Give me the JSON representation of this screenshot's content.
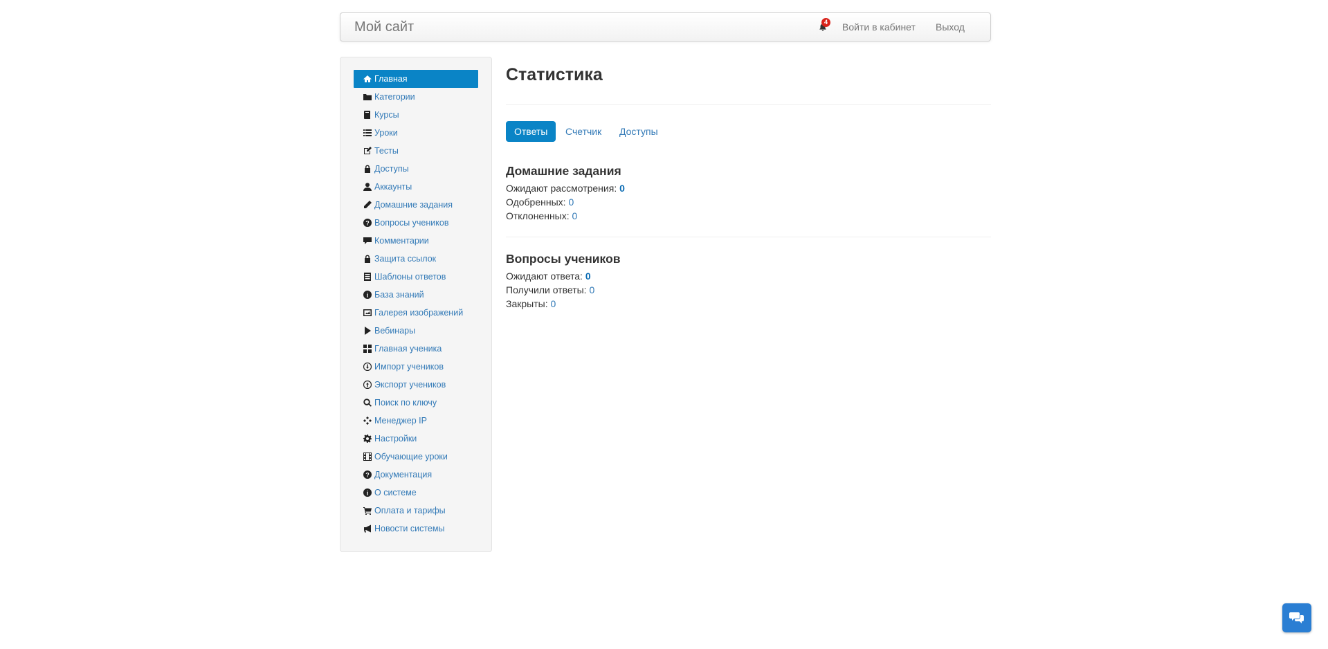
{
  "navbar": {
    "brand": "Мой сайт",
    "notification_count": "4",
    "links": [
      "Войти в кабинет",
      "Выход"
    ]
  },
  "sidebar": {
    "items": [
      {
        "label": "Главная",
        "icon": "home-icon",
        "active": true
      },
      {
        "label": "Категории",
        "icon": "folder-icon"
      },
      {
        "label": "Курсы",
        "icon": "book-icon"
      },
      {
        "label": "Уроки",
        "icon": "list-icon"
      },
      {
        "label": "Тесты",
        "icon": "edit-icon"
      },
      {
        "label": "Доступы",
        "icon": "lock-icon"
      },
      {
        "label": "Аккаунты",
        "icon": "user-icon"
      },
      {
        "label": "Домашние задания",
        "icon": "pencil-icon"
      },
      {
        "label": "Вопросы учеников",
        "icon": "question-icon"
      },
      {
        "label": "Комментарии",
        "icon": "comment-icon"
      },
      {
        "label": "Защита ссылок",
        "icon": "lock-icon"
      },
      {
        "label": "Шаблоны ответов",
        "icon": "template-icon"
      },
      {
        "label": "База знаний",
        "icon": "info-icon"
      },
      {
        "label": "Галерея изображений",
        "icon": "image-icon"
      },
      {
        "label": "Вебинары",
        "icon": "play-icon"
      },
      {
        "label": "Главная ученика",
        "icon": "dashboard-icon"
      },
      {
        "label": "Импорт учеников",
        "icon": "import-icon"
      },
      {
        "label": "Экспорт учеников",
        "icon": "export-icon"
      },
      {
        "label": "Поиск по ключу",
        "icon": "search-icon"
      },
      {
        "label": "Менеджер IP",
        "icon": "network-icon"
      },
      {
        "label": "Настройки",
        "icon": "gear-icon"
      },
      {
        "label": "Обучающие уроки",
        "icon": "film-icon"
      },
      {
        "label": "Документация",
        "icon": "question-icon"
      },
      {
        "label": "О системе",
        "icon": "info-icon"
      },
      {
        "label": "Оплата и тарифы",
        "icon": "cart-icon"
      },
      {
        "label": "Новости системы",
        "icon": "bullhorn-icon"
      }
    ]
  },
  "main": {
    "title": "Статистика",
    "tabs": [
      {
        "label": "Ответы",
        "active": true
      },
      {
        "label": "Счетчик"
      },
      {
        "label": "Доступы"
      }
    ],
    "homework": {
      "title": "Домашние задания",
      "rows": [
        {
          "label": "Ожидают рассмотрения:",
          "value": "0"
        },
        {
          "label": "Одобренных:",
          "value": "0"
        },
        {
          "label": "Отклоненных:",
          "value": "0"
        }
      ]
    },
    "questions": {
      "title": "Вопросы учеников",
      "rows": [
        {
          "label": "Ожидают ответа:",
          "value": "0"
        },
        {
          "label": "Получили ответы:",
          "value": "0"
        },
        {
          "label": "Закрыты:",
          "value": "0"
        }
      ]
    }
  },
  "chat_widget": {
    "icon": "chat-icon"
  },
  "colors": {
    "accent": "#0a84c6",
    "link": "#337ab7",
    "badge": "#d9231b",
    "chat": "#2a7ed3"
  }
}
